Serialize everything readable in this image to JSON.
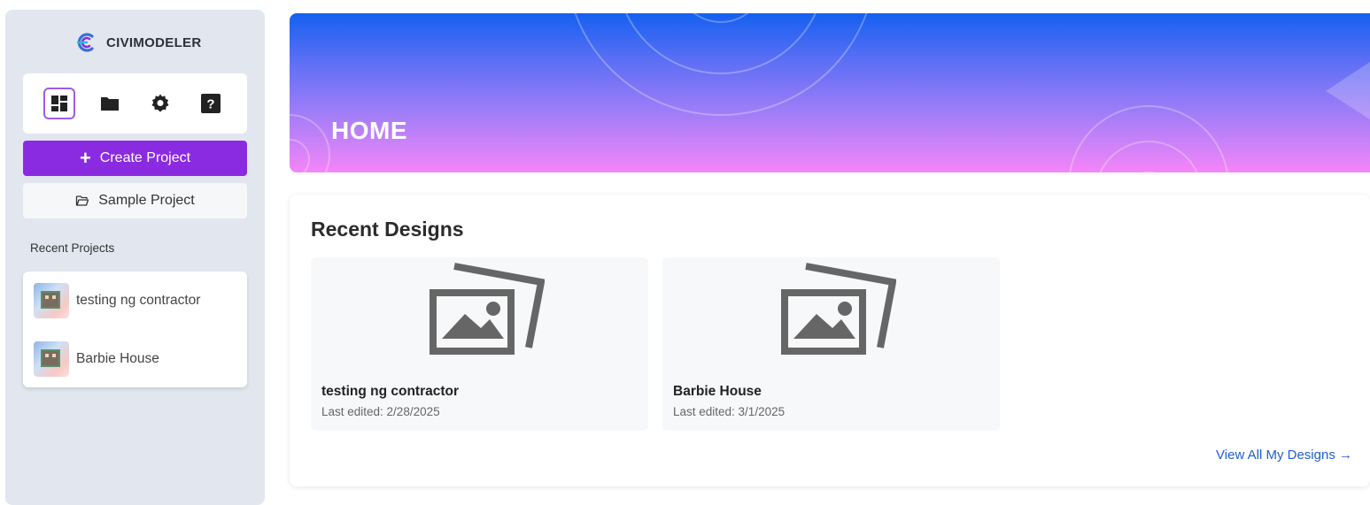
{
  "brand": {
    "name": "CIVIMODELER",
    "logo_icon": "civimodeler-logo-icon"
  },
  "nav": {
    "items": [
      {
        "icon": "dashboard-icon",
        "active": true
      },
      {
        "icon": "folder-icon",
        "active": false
      },
      {
        "icon": "gear-icon",
        "active": false
      },
      {
        "icon": "help-icon",
        "active": false
      }
    ]
  },
  "sidebar": {
    "create_label": "Create Project",
    "sample_label": "Sample Project",
    "recent_label": "Recent Projects",
    "recent_projects": [
      {
        "name": "testing ng contractor"
      },
      {
        "name": "Barbie House"
      }
    ]
  },
  "hero": {
    "title": "HOME"
  },
  "designs": {
    "title": "Recent Designs",
    "items": [
      {
        "name": "testing ng contractor",
        "edited": "Last edited: 2/28/2025"
      },
      {
        "name": "Barbie House",
        "edited": "Last edited: 3/1/2025"
      }
    ],
    "view_all": "View All My Designs →"
  },
  "colors": {
    "accent": "#8a2be2",
    "link": "#1f5fd1",
    "sidebar_bg": "#e2e7ef"
  }
}
